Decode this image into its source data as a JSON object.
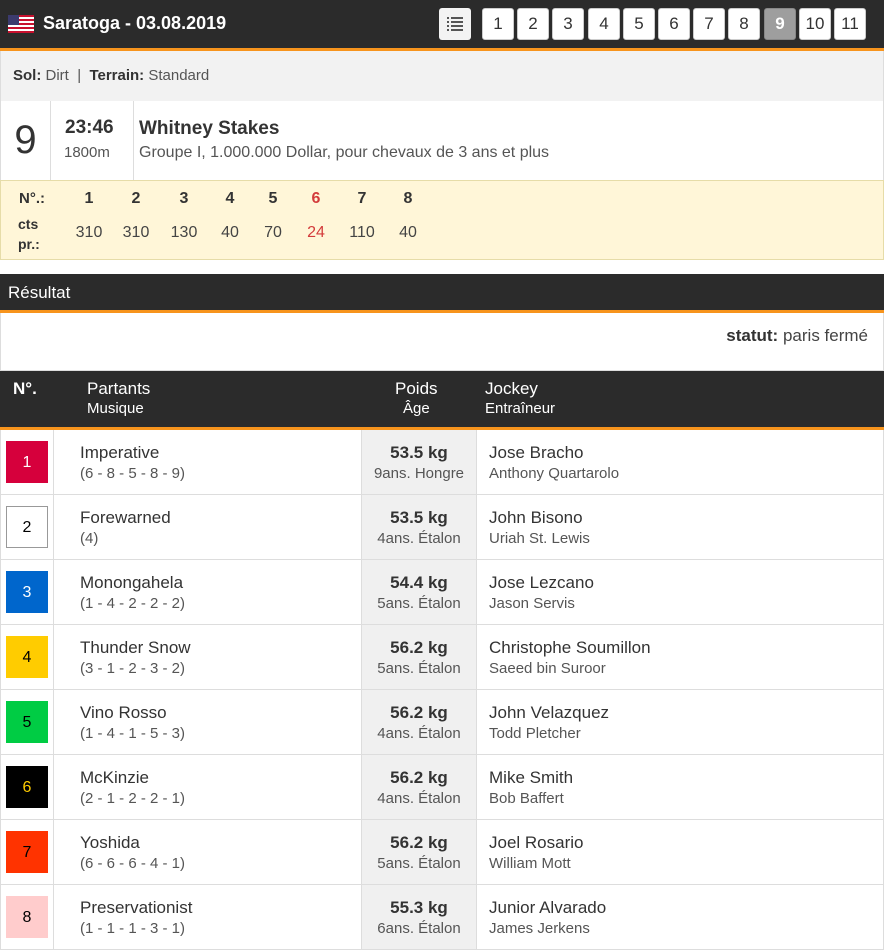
{
  "header": {
    "title": "Saratoga - 03.08.2019",
    "flag_icon": "us-flag-icon",
    "list_icon": "list-icon",
    "races": [
      "1",
      "2",
      "3",
      "4",
      "5",
      "6",
      "7",
      "8",
      "9",
      "10",
      "11"
    ],
    "active_race": "9"
  },
  "conditions": {
    "sol_label": "Sol:",
    "sol_value": "Dirt",
    "separator": "|",
    "terrain_label": "Terrain:",
    "terrain_value": "Standard"
  },
  "race": {
    "number": "9",
    "time": "23:46",
    "distance": "1800m",
    "name": "Whitney Stakes",
    "description": "Groupe I, 1.000.000 Dollar, pour chevaux de 3 ans et plus"
  },
  "odds": {
    "no_label": "N°.:",
    "cts_label": "cts",
    "pr_label": "pr.:",
    "numbers": [
      "1",
      "2",
      "3",
      "4",
      "5",
      "6",
      "7",
      "8"
    ],
    "values": [
      "310",
      "310",
      "130",
      "40",
      "70",
      "24",
      "110",
      "40"
    ],
    "favorite_color": "#d33b3b"
  },
  "result": {
    "section_title": "Résultat",
    "status_label": "statut:",
    "status_value": "paris fermé"
  },
  "table": {
    "col_no": "N°.",
    "col_partants": "Partants",
    "col_musique": "Musique",
    "col_poids": "Poids",
    "col_age": "Âge",
    "col_jockey": "Jockey",
    "col_entraineur": "Entraîneur",
    "rows": [
      {
        "no": "1",
        "name": "Imperative",
        "music": "(6 - 8 - 5 - 8 - 9)",
        "weight": "53.5 kg",
        "age": "9ans. Hongre",
        "jockey": "Jose Bracho",
        "trainer": "Anthony Quartarolo",
        "bg": "#d6003c",
        "fg": "#ffffff",
        "border": "#d6003c"
      },
      {
        "no": "2",
        "name": "Forewarned",
        "music": "(4)",
        "weight": "53.5 kg",
        "age": "4ans. Étalon",
        "jockey": "John Bisono",
        "trainer": "Uriah St. Lewis",
        "bg": "#ffffff",
        "fg": "#000000",
        "border": "#999999"
      },
      {
        "no": "3",
        "name": "Monongahela",
        "music": "(1 - 4 - 2 - 2 - 2)",
        "weight": "54.4 kg",
        "age": "5ans. Étalon",
        "jockey": "Jose Lezcano",
        "trainer": "Jason Servis",
        "bg": "#0066cc",
        "fg": "#ffffff",
        "border": "#0066cc"
      },
      {
        "no": "4",
        "name": "Thunder Snow",
        "music": "(3 - 1 - 2 - 3 - 2)",
        "weight": "56.2 kg",
        "age": "5ans. Étalon",
        "jockey": "Christophe Soumillon",
        "trainer": "Saeed bin Suroor",
        "bg": "#ffcc00",
        "fg": "#000000",
        "border": "#ffcc00"
      },
      {
        "no": "5",
        "name": "Vino Rosso",
        "music": "(1 - 4 - 1 - 5 - 3)",
        "weight": "56.2 kg",
        "age": "4ans. Étalon",
        "jockey": "John Velazquez",
        "trainer": "Todd Pletcher",
        "bg": "#00cc44",
        "fg": "#000000",
        "border": "#00cc44"
      },
      {
        "no": "6",
        "name": "McKinzie",
        "music": "(2 - 1 - 2 - 2 - 1)",
        "weight": "56.2 kg",
        "age": "4ans. Étalon",
        "jockey": "Mike Smith",
        "trainer": "Bob Baffert",
        "bg": "#000000",
        "fg": "#ffcc00",
        "border": "#000000"
      },
      {
        "no": "7",
        "name": "Yoshida",
        "music": "(6 - 6 - 6 - 4 - 1)",
        "weight": "56.2 kg",
        "age": "5ans. Étalon",
        "jockey": "Joel Rosario",
        "trainer": "William Mott",
        "bg": "#ff3300",
        "fg": "#000000",
        "border": "#ff3300"
      },
      {
        "no": "8",
        "name": "Preservationist",
        "music": "(1 - 1 - 1 - 3 - 1)",
        "weight": "55.3 kg",
        "age": "6ans. Étalon",
        "jockey": "Junior Alvarado",
        "trainer": "James Jerkens",
        "bg": "#ffcccc",
        "fg": "#000000",
        "border": "#ffcccc"
      }
    ]
  },
  "colors": {
    "dark_bar": "#2b2b2b",
    "accent": "#f7941d",
    "odds_bg": "#fff6d8"
  }
}
